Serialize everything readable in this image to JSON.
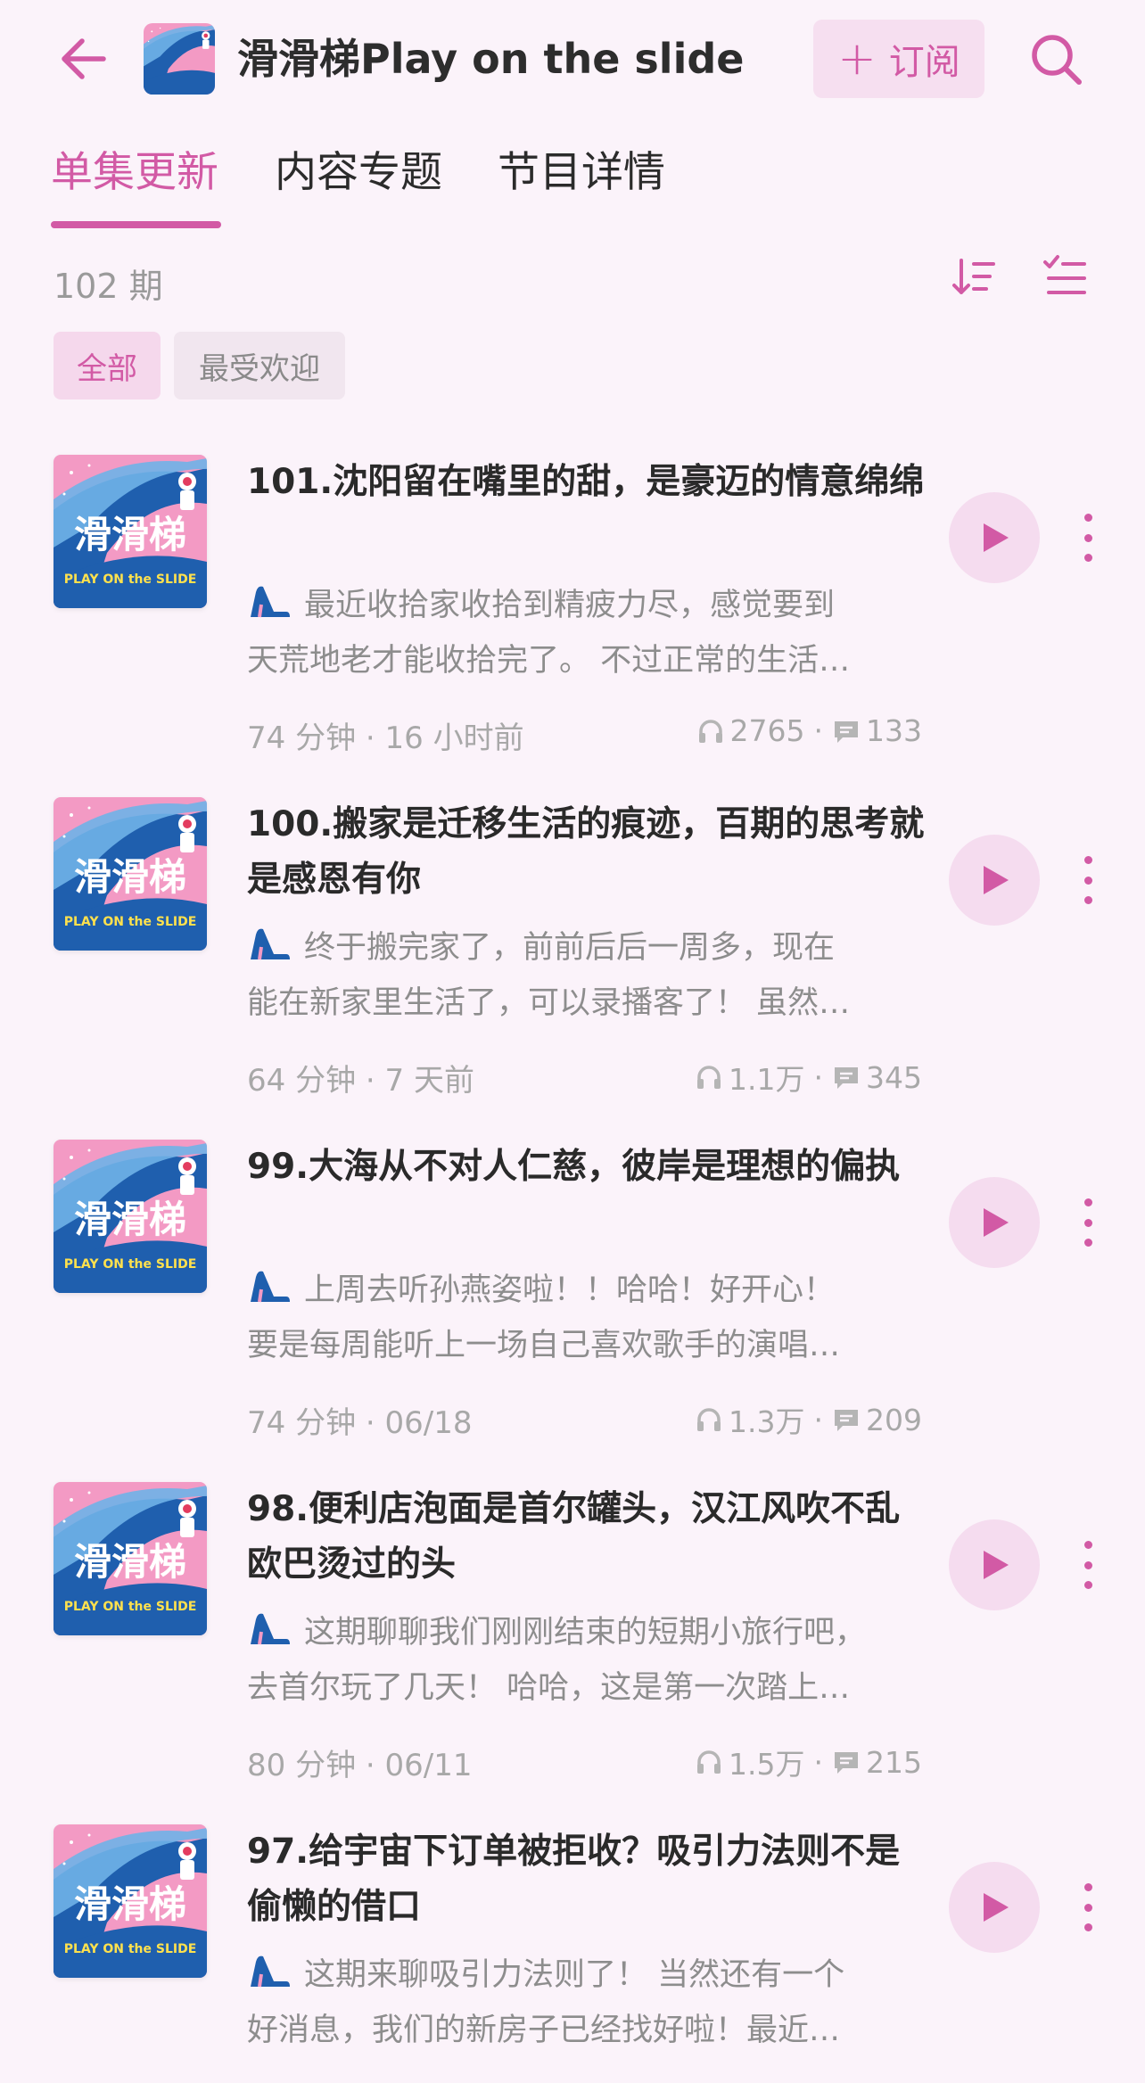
{
  "header": {
    "podcast_title": "滑滑梯Play on the slide",
    "subscribe_label": "订阅"
  },
  "tabs": [
    {
      "label": "单集更新",
      "active": true
    },
    {
      "label": "内容专题",
      "active": false
    },
    {
      "label": "节目详情",
      "active": false
    }
  ],
  "episode_count": "102 期",
  "filters": [
    {
      "label": "全部",
      "active": true
    },
    {
      "label": "最受欢迎",
      "active": false
    }
  ],
  "cover": {
    "main": "滑滑梯",
    "tagline": "PLAY ON the SLIDE"
  },
  "colors": {
    "accent": "#d25aa5",
    "cover_pink": "#f39ac4",
    "cover_blue": "#1f5fae"
  },
  "episodes": [
    {
      "title": "101.沈阳留在嘴里的甜，是豪迈的情意绵绵",
      "desc_line1": "最近收拾家收拾到精疲力尽，感觉要到",
      "desc_line2": "天荒地老才能收拾完了。 不过正常的生活…",
      "duration": "74 分钟",
      "date": "16 小时前",
      "plays": "2765",
      "comments": "133"
    },
    {
      "title": "100.搬家是迁移生活的痕迹，百期的思考就是感恩有你",
      "desc_line1": "终于搬完家了，前前后后一周多，现在",
      "desc_line2": "能在新家里生活了，可以录播客了！ 虽然…",
      "duration": "64 分钟",
      "date": "7 天前",
      "plays": "1.1万",
      "comments": "345"
    },
    {
      "title": "99.大海从不对人仁慈，彼岸是理想的偏执",
      "desc_line1": "上周去听孙燕姿啦！！哈哈！好开心！",
      "desc_line2": "要是每周能听上一场自己喜欢歌手的演唱…",
      "duration": "74 分钟",
      "date": "06/18",
      "plays": "1.3万",
      "comments": "209"
    },
    {
      "title": "98.便利店泡面是首尔罐头，汉江风吹不乱欧巴烫过的头",
      "desc_line1": "这期聊聊我们刚刚结束的短期小旅行吧，",
      "desc_line2": "去首尔玩了几天！ 哈哈，这是第一次踏上…",
      "duration": "80 分钟",
      "date": "06/11",
      "plays": "1.5万",
      "comments": "215"
    },
    {
      "title": "97.给宇宙下订单被拒收？吸引力法则不是偷懒的借口",
      "desc_line1": "这期来聊吸引力法则了！ 当然还有一个",
      "desc_line2": "好消息，我们的新房子已经找好啦！最近…",
      "duration": "",
      "date": "",
      "plays": "",
      "comments": ""
    }
  ]
}
